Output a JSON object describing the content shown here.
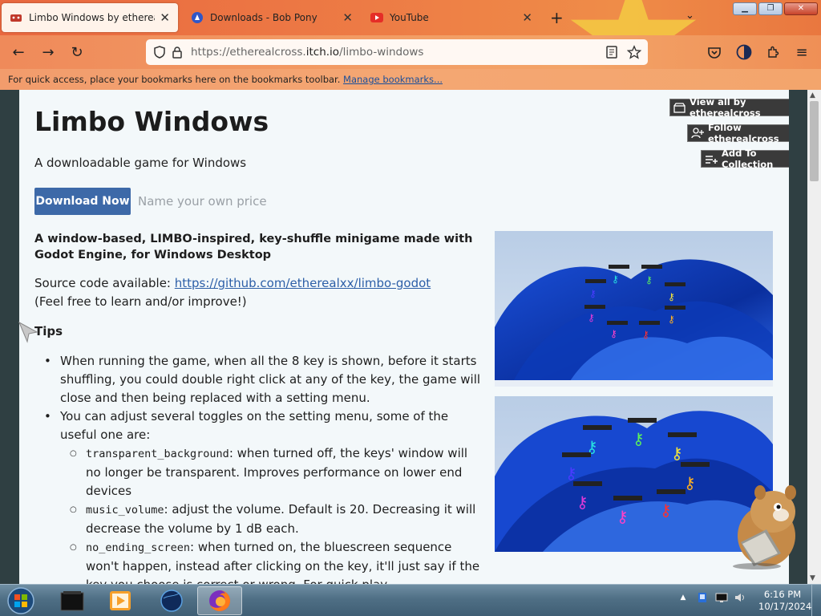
{
  "browser": {
    "tabs": [
      {
        "label": "Limbo Windows by etherealcro",
        "active": true,
        "icon": "itch-icon"
      },
      {
        "label": "Downloads - Bob Pony",
        "active": false,
        "icon": "bobpony-icon"
      },
      {
        "label": "YouTube",
        "active": false,
        "icon": "youtube-icon"
      }
    ],
    "new_tab": "+",
    "url_domain_prefix": "https://etherealcross.",
    "url_domain": "itch.io",
    "url_path": "/limbo-windows",
    "bookmarks_msg": "For quick access, place your bookmarks here on the bookmarks toolbar.",
    "bookmarks_link": "Manage bookmarks..."
  },
  "page": {
    "title": "Limbo Windows",
    "subtitle": "A downloadable game for Windows",
    "download_label": "Download Now",
    "price_label": "Name your own price",
    "side_buttons": {
      "view_all": "View all by etherealcross",
      "follow": "Follow etherealcross",
      "collection": "Add To Collection"
    },
    "description": {
      "lead": "A window-based, LIMBO-inspired, key-shuffle minigame made with Godot Engine, for Windows Desktop",
      "source_prefix": "Source code available: ",
      "source_link": "https://github.com/etherealxx/limbo-godot",
      "source_note": "(Feel free to learn and/or improve!)",
      "tips_heading": "Tips",
      "tip1": "When running the game, when all the 8 key is shown, before it starts shuffling, you could double right click at any of the key, the game will close and then being replaced with a setting menu.",
      "tip2": "You can adjust several toggles on the setting menu, some of the useful one are:",
      "sub1_code": "transparent_background",
      "sub1_text": ": when turned off, the keys' window will no longer be transparent. Improves performance on lower end devices",
      "sub2_code": "music_volume",
      "sub2_text": ": adjust the volume. Default is 20. Decreasing it will decrease the volume by 1 dB each.",
      "sub3_code": "no_ending_screen",
      "sub3_text": ": when turned on, the bluescreen sequence won't happen, instead after clicking on the key, it'll just say if the key you choose is correct or wrong. For quick play."
    }
  },
  "taskbar": {
    "time": "6:16 PM",
    "date": "10/17/2024"
  },
  "colors": {
    "accent": "#3d69a8",
    "link": "#2d5fa8",
    "tab_gradient_start": "#e9683f"
  }
}
